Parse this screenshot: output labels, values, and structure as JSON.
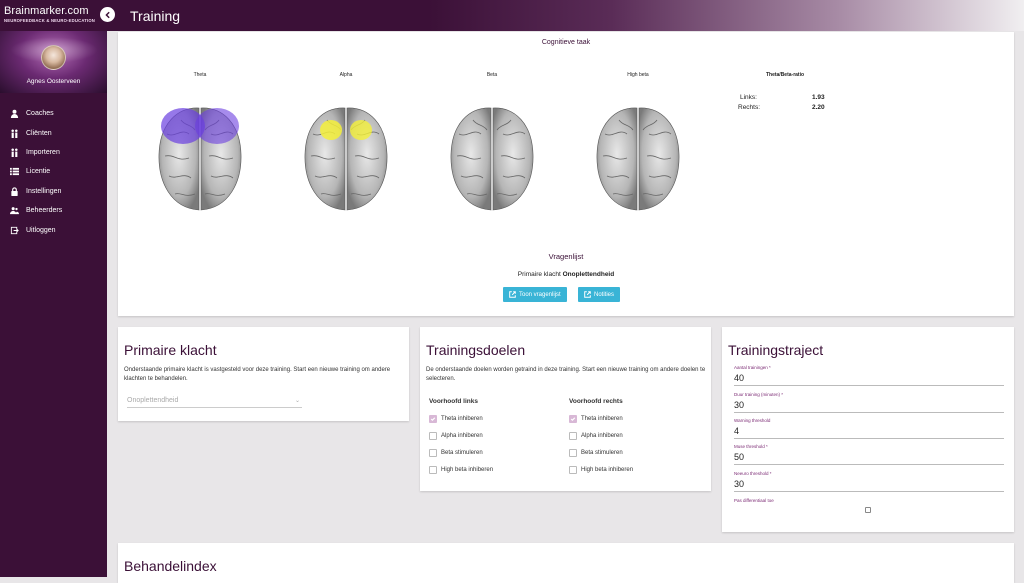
{
  "brand": {
    "name": "Brainmarker.com",
    "subtitle": "NEUROFEEDBACK & NEURO-EDUCATION"
  },
  "profile": {
    "name": "Agnes Oosterveen"
  },
  "nav": [
    {
      "label": "Coaches",
      "icon": "person-icon"
    },
    {
      "label": "Cliënten",
      "icon": "people-icon"
    },
    {
      "label": "Importeren",
      "icon": "people-icon"
    },
    {
      "label": "Licentie",
      "icon": "list-icon"
    },
    {
      "label": "Instellingen",
      "icon": "lock-icon"
    },
    {
      "label": "Beheerders",
      "icon": "group-icon"
    },
    {
      "label": "Uitloggen",
      "icon": "logout-icon"
    }
  ],
  "header": {
    "title": "Training"
  },
  "cognitive": {
    "title": "Cognitieve taak",
    "bands": [
      "Theta",
      "Alpha",
      "Beta",
      "High beta"
    ],
    "ratio_title": "Theta/Beta-ratio",
    "left_label": "Links:",
    "left_value": "1.93",
    "right_label": "Rechts:",
    "right_value": "2.20",
    "highlight_colors": {
      "theta": "#6a3ee0",
      "alpha": "#f4f03a"
    }
  },
  "questionnaire": {
    "title": "Vragenlijst",
    "primary_prefix": "Primaire klacht",
    "primary_value": "Onoplettendheid",
    "show_button": "Toon vragenlijst",
    "notes_button": "Notities"
  },
  "primary": {
    "title": "Primaire klacht",
    "description": "Onderstaande primaire klacht is vastgesteld voor deze training. Start een nieuwe training om andere klachten te behandelen.",
    "selected": "Onoplettendheid"
  },
  "goals": {
    "title": "Trainingsdoelen",
    "description": "De onderstaande doelen worden getraind in deze training. Start een nieuwe training om andere doelen te selecteren.",
    "left_head": "Voorhoofd links",
    "right_head": "Voorhoofd rechts",
    "items": [
      {
        "label": "Theta inhiberen",
        "left": true,
        "right": true
      },
      {
        "label": "Alpha inhiberen",
        "left": false,
        "right": false
      },
      {
        "label": "Beta stimuleren",
        "left": false,
        "right": false
      },
      {
        "label": "High beta inhiberen",
        "left": false,
        "right": false
      }
    ]
  },
  "traject": {
    "title": "Trainingstraject",
    "fields": [
      {
        "label": "Aantal trainingen *",
        "value": "40"
      },
      {
        "label": "Duur training (minuten) *",
        "value": "30"
      },
      {
        "label": "Warning threshold",
        "value": "4"
      },
      {
        "label": "Muse threshold *",
        "value": "50"
      },
      {
        "label": "Neeuro threshold *",
        "value": "30"
      }
    ],
    "differential_label": "Pas differentiaal toe"
  },
  "behandel": {
    "title": "Behandelindex"
  },
  "colors": {
    "sidebar": "#3b1037",
    "accent": "#39b4d6",
    "title": "#3b1037"
  }
}
